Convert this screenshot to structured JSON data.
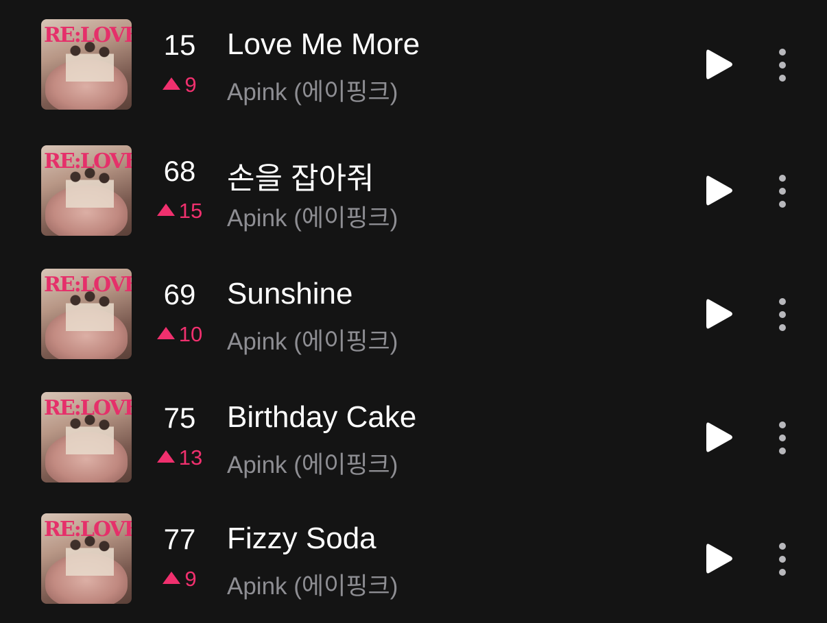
{
  "chart_list": {
    "items": [
      {
        "rank": "15",
        "change": "9",
        "title": "Love Me More",
        "artist": "Apink (에이핑크)",
        "cover_text": "RE:LOVE"
      },
      {
        "rank": "68",
        "change": "15",
        "title": "손을 잡아줘",
        "artist": "Apink (에이핑크)",
        "cover_text": "RE:LOVE"
      },
      {
        "rank": "69",
        "change": "10",
        "title": "Sunshine",
        "artist": "Apink (에이핑크)",
        "cover_text": "RE:LOVE"
      },
      {
        "rank": "75",
        "change": "13",
        "title": "Birthday Cake",
        "artist": "Apink (에이핑크)",
        "cover_text": "RE:LOVE"
      },
      {
        "rank": "77",
        "change": "9",
        "title": "Fizzy Soda",
        "artist": "Apink (에이핑크)",
        "cover_text": "RE:LOVE"
      }
    ]
  },
  "colors": {
    "background": "#141414",
    "rank_up": "#f0306e",
    "title": "#ffffff",
    "artist": "#8e8e93",
    "icon_more": "#b8b8bc"
  },
  "icons": {
    "play": "play-icon",
    "more": "more-vertical-icon",
    "rank_change": "triangle-up-icon"
  }
}
